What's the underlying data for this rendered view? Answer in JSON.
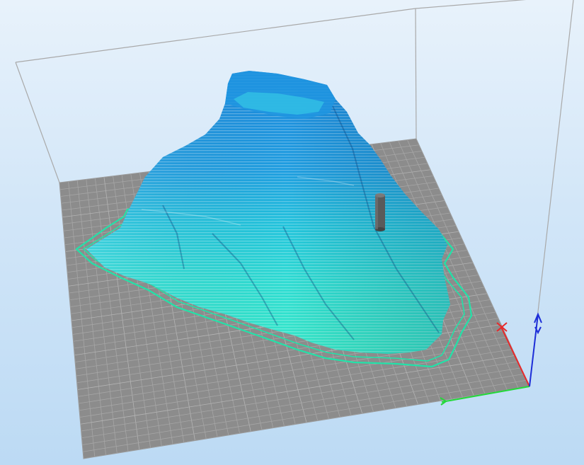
{
  "viewer": {
    "background_top": "#e8f2fb",
    "background_bottom": "#bcdaf4",
    "bed_color": "#8e8e8e",
    "grid_color": "#a8a8a8",
    "build_volume_color": "#a9a9a9",
    "model_color_base": "#2fe6cf",
    "model_color_top": "#1a7fd6",
    "skirt_color": "#22e2a8",
    "axes": {
      "x_color": "#e8282a",
      "y_color": "#24d83a",
      "z_color": "#1d2ed8",
      "x_icon": "x-axis-arrow-icon",
      "y_icon": "y-axis-arrow-icon",
      "z_icon": "z-axis-arrow-icon"
    }
  }
}
